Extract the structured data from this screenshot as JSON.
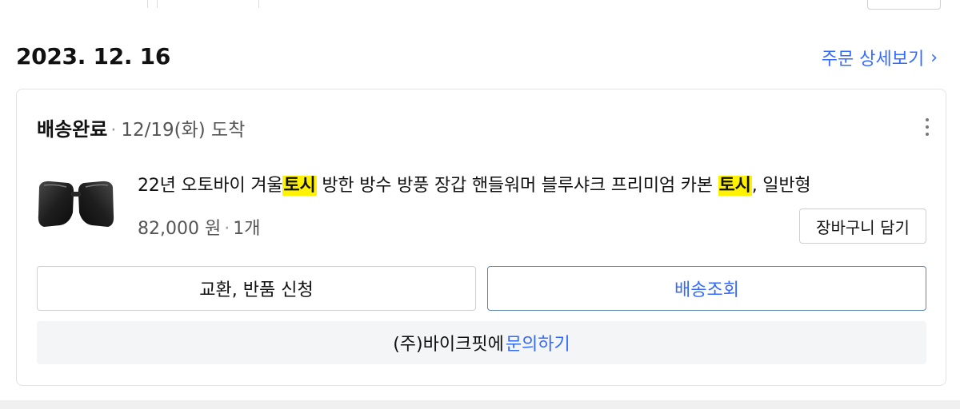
{
  "order": {
    "date": "2023. 12. 16",
    "detail_link": "주문 상세보기",
    "detail_chevron": "›"
  },
  "shipment": {
    "status": "배송완료",
    "separator": "·",
    "arrival": "12/19(화) 도착",
    "more_icon": "more-vertical-icon"
  },
  "product": {
    "name_parts": [
      "22년 오토바이 겨울",
      "토시",
      " 방한 방수 방풍 장갑 핸들워머 블루샤크 프리미엄 카본 ",
      "토시",
      ", 일반형"
    ],
    "price": "82,000 원",
    "price_separator": "·",
    "quantity": "1개",
    "thumbnail": "handlebar-muff-image",
    "highlight_color": "#fff200"
  },
  "buttons": {
    "add_to_cart": "장바구니 담기",
    "exchange_return": "교환, 반품 신청",
    "track_delivery": "배송조회"
  },
  "inquiry": {
    "seller": "(주)바이크핏에",
    "link": "문의하기"
  },
  "colors": {
    "accent": "#346aff",
    "track_border": "#5b87a8"
  }
}
